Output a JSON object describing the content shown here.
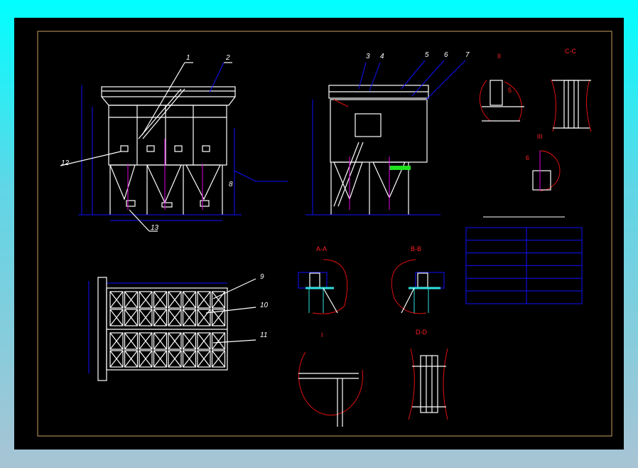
{
  "drawing": {
    "balloons": {
      "b1": "1",
      "b2": "2",
      "b3": "3",
      "b4": "4",
      "b5": "5",
      "b6": "6",
      "b7": "7",
      "b8": "8",
      "b9": "9",
      "b10": "10",
      "b11": "11",
      "b12": "12",
      "b13": "13"
    },
    "sections": {
      "detail_2": "II",
      "cc": "C-C",
      "detail_3": "III",
      "aa": "A-A",
      "bb": "B-B",
      "detail_1": "I",
      "dd": "D-D"
    },
    "welds": {
      "w5": "5",
      "w6": "6"
    },
    "table_rows": 6
  },
  "colors": {
    "background_top": "#00ffff",
    "sheet": "#000000",
    "border": "#c8a060",
    "dimension": "#1010ff",
    "detail": "#e01010",
    "geometry": "#ffffff"
  }
}
